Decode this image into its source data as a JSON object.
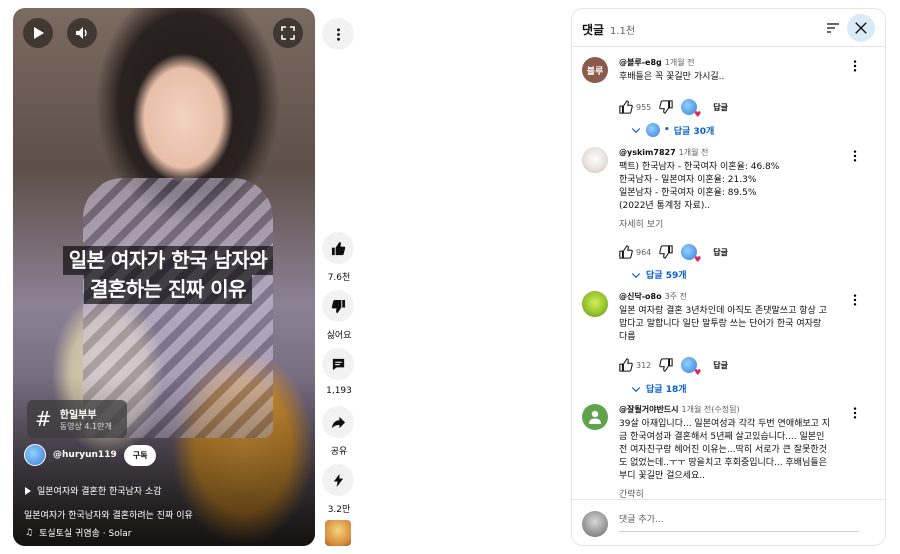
{
  "video": {
    "caption_line1": "일본 여자가 한국 남자와",
    "caption_line2": "결혼하는 진짜 이유",
    "tag_title": "한일부부",
    "tag_subtitle": "동영상 4.1만개",
    "channel_name": "@huryun119",
    "subscribe_label": "구독",
    "related_title": "일본여자와 결혼한 한국남자 소감",
    "description": "일본여자가 한국남자와 결혼하려는 진짜 이유",
    "music": "토실토실 귀염송 · Solar"
  },
  "rail": {
    "like_count": "7.6천",
    "dislike_label": "싫어요",
    "comment_count": "1,193",
    "share_label": "공유",
    "remix_count": "3.2만"
  },
  "comments_panel": {
    "title": "댓글",
    "count": "1.1천",
    "input_placeholder": "댓글 추가...",
    "reply_label": "답글",
    "more_label": "자세히 보기",
    "short_label": "간략히",
    "comments": [
      {
        "author": "@블루-e8g",
        "time": "1개월 전",
        "avatar_text": "블루",
        "avatar_color": "#8a5a4a",
        "lines": [
          "후배들은 꼭 꽃길만 가시길.."
        ],
        "likes": "955",
        "replies": "답글 30개"
      },
      {
        "author": "@yskim7827",
        "time": "1개월 전",
        "lines": [
          "팩트) 한국남자 - 한국여자 이혼율: 46.8%",
          "한국남자 - 일본여자 이혼율: 21.3%",
          "일본남자 - 한국여자 이혼율: 89.5%",
          "(2022년 통계청 자료).."
        ],
        "likes": "964",
        "replies": "답글 59개"
      },
      {
        "author": "@신닥-o8o",
        "time": "3주 전",
        "lines": [
          "일본 여자랑 결혼 3년차인데 아직도 존댓말쓰고 항상 고",
          "맙다고 말합니다 일단 말투랑 쓰는 단어가 한국 여자랑",
          "다름"
        ],
        "likes": "312",
        "replies": "답글 18개"
      },
      {
        "author": "@잘될거야반드시",
        "time": "1개월 전(수정됨)",
        "lines": [
          "39살 아재입니다... 일본여성과 각각 두번 연애해보고 지",
          "금 한국여성과 결혼해서 5년째 살고있습니다.... 일본인",
          "전 여자친구랑 헤어진 이유는...딱히 서로가 큰 잘못한것",
          "도 없었는데..ㅜㅜ 땅을치고 후회중입니다... 후배님들은",
          "부디 꽃길만 걸으세요.."
        ]
      }
    ]
  }
}
